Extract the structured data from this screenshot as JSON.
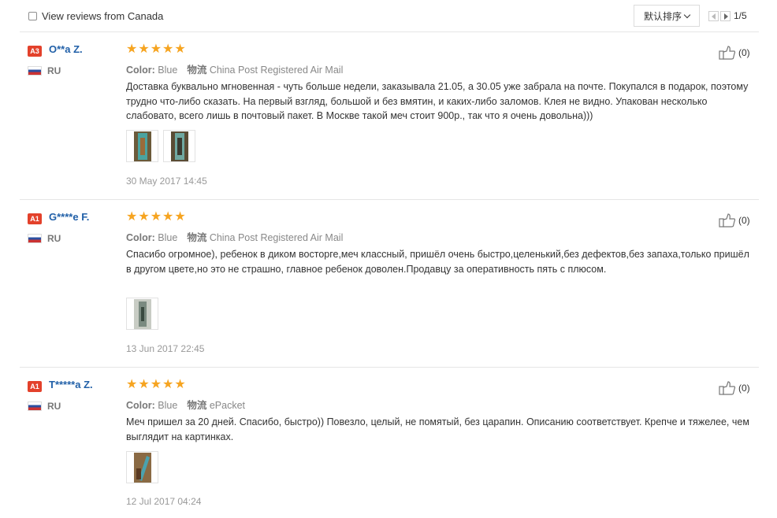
{
  "toolbar": {
    "filter_label": "View reviews from Canada",
    "sort_label": "默认排序",
    "page_indicator": "1/5"
  },
  "reviews": [
    {
      "level": "A3",
      "name": "O**a Z.",
      "country": "RU",
      "rating": 5,
      "color_label": "Color:",
      "color_value": "Blue",
      "shipping_label": "物流",
      "shipping_value": "China Post Registered Air Mail",
      "text": "Доставка буквально мгновенная - чуть больше недели, заказывала 21.05, а 30.05 уже забрала на почте. Покупался в подарок, поэтому трудно что-либо сказать. На первый взгляд, большой и без вмятин, и каких-либо заломов. Клея не видно. Упакован несколько слабовато, всего лишь в почтовый пакет. В Москве такой меч стоит 900р., так что я очень довольна)))",
      "photos": 2,
      "date": "30 May 2017 14:45",
      "likes": "(0)"
    },
    {
      "level": "A1",
      "name": "G****e F.",
      "country": "RU",
      "rating": 5,
      "color_label": "Color:",
      "color_value": "Blue",
      "shipping_label": "物流",
      "shipping_value": "China Post Registered Air Mail",
      "text": "Спасибо огромное), ребенок в диком восторге,меч классный, пришёл очень быстро,целенький,без дефектов,без запаха,только пришёл в другом цвете,но это не страшно, главное ребенок доволен.Продавцу за оперативность пять с плюсом.",
      "photos": 1,
      "date": "13 Jun 2017 22:45",
      "likes": "(0)"
    },
    {
      "level": "A1",
      "name": "T*****a Z.",
      "country": "RU",
      "rating": 5,
      "color_label": "Color:",
      "color_value": "Blue",
      "shipping_label": "物流",
      "shipping_value": "ePacket",
      "text": "Меч пришел за 20 дней. Спасибо, быстро)) Повезло, целый, не помятый, без царапин. Описанию соответствует. Крепче и тяжелее, чем выглядит на картинках.",
      "photos": 1,
      "date": "12 Jul 2017 04:24",
      "likes": "(0)"
    }
  ],
  "colors": {
    "name": "#2160a8",
    "star": "#f6a420",
    "level_badge": "#e3412b"
  }
}
